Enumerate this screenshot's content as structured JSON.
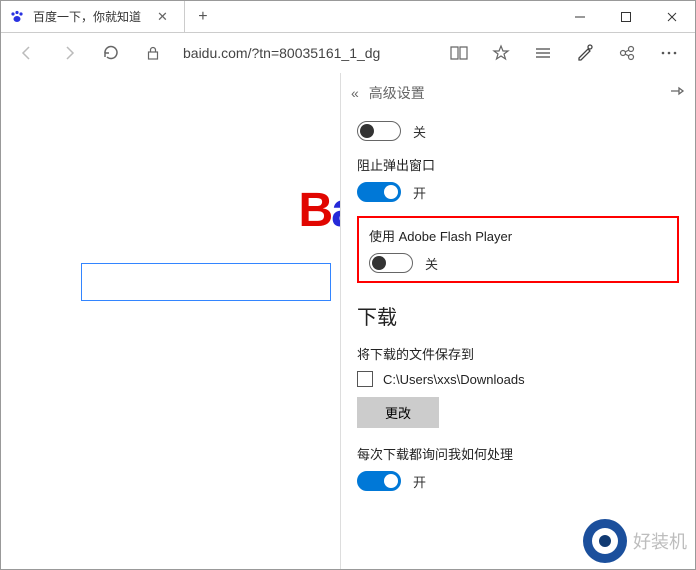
{
  "tab": {
    "title": "百度一下，你就知道"
  },
  "address": "baidu.com/?tn=80035161_1_dg",
  "panel": {
    "title": "高级设置",
    "setting_off1_state": "关",
    "block_popups_label": "阻止弹出窗口",
    "block_popups_state": "开",
    "flash_label": "使用 Adobe Flash Player",
    "flash_state": "关",
    "downloads_heading": "下载",
    "save_location_label": "将下载的文件保存到",
    "save_path": "C:\\Users\\xxs\\Downloads",
    "change_button": "更改",
    "ask_each_time_label": "每次下载都询问我如何处理",
    "ask_each_time_state": "开"
  },
  "baidu_logo_prefix": "B",
  "baidu_logo_rest": "ai",
  "watermark": "好装机"
}
